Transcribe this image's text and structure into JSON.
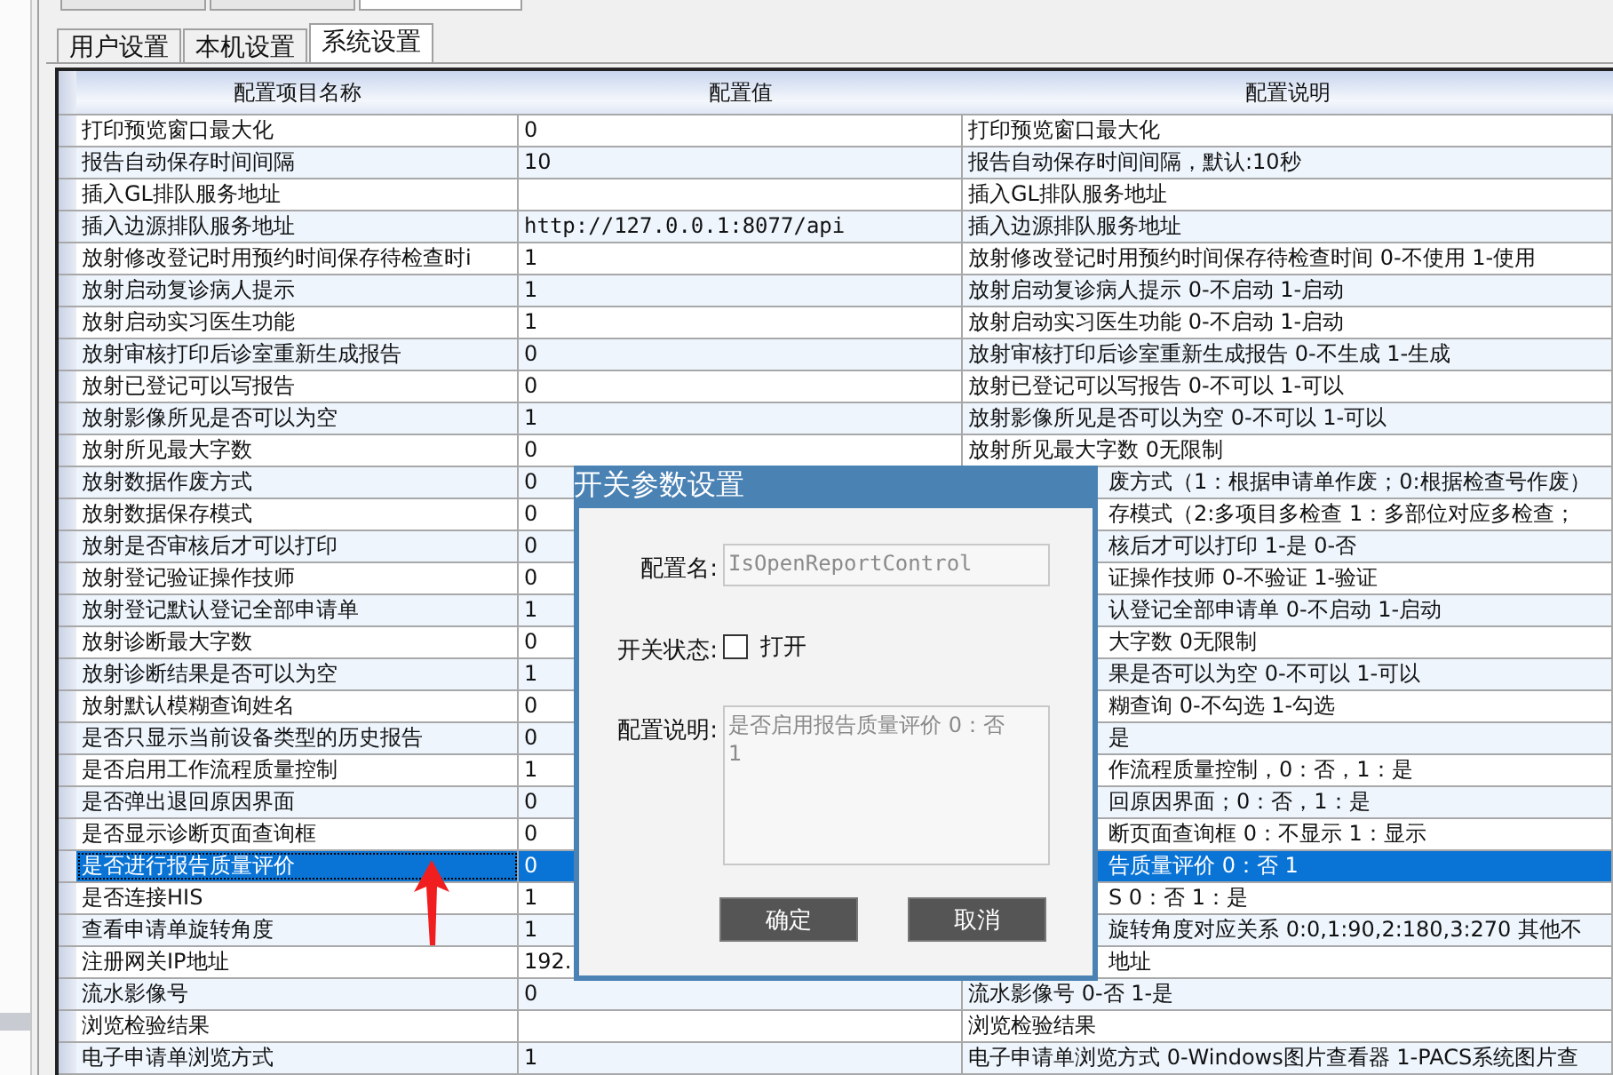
{
  "outer_tabs": [
    {
      "selected": false
    },
    {
      "selected": false
    },
    {
      "selected": true
    }
  ],
  "tabs": [
    {
      "label": "用户设置",
      "selected": false
    },
    {
      "label": "本机设置",
      "selected": false
    },
    {
      "label": "系统设置",
      "selected": true
    }
  ],
  "table": {
    "columns": [
      "配置项目名称",
      "配置值",
      "配置说明"
    ],
    "rows": [
      {
        "name": "打印预览窗口最大化",
        "value": "0",
        "description": "打印预览窗口最大化",
        "covered_by_dialog": false,
        "selected": false
      },
      {
        "name": "报告自动保存时间间隔",
        "value": "10",
        "description": "报告自动保存时间间隔，默认:10秒",
        "covered_by_dialog": false,
        "selected": false
      },
      {
        "name": "插入GL排队服务地址",
        "value": "",
        "description": "插入GL排队服务地址",
        "covered_by_dialog": false,
        "selected": false
      },
      {
        "name": "插入边源排队服务地址",
        "value": "http://127.0.0.1:8077/api",
        "description": "插入边源排队服务地址",
        "covered_by_dialog": false,
        "selected": false
      },
      {
        "name": "放射修改登记时用预约时间保存待检查时i",
        "value": "1",
        "description": "放射修改登记时用预约时间保存待检查时间 0-不使用 1-使用",
        "covered_by_dialog": false,
        "selected": false
      },
      {
        "name": "放射启动复诊病人提示",
        "value": "1",
        "description": "放射启动复诊病人提示 0-不启动 1-启动",
        "covered_by_dialog": false,
        "selected": false
      },
      {
        "name": "放射启动实习医生功能",
        "value": "1",
        "description": "放射启动实习医生功能 0-不启动 1-启动",
        "covered_by_dialog": false,
        "selected": false
      },
      {
        "name": "放射审核打印后诊室重新生成报告",
        "value": "0",
        "description": "放射审核打印后诊室重新生成报告 0-不生成 1-生成",
        "covered_by_dialog": false,
        "selected": false
      },
      {
        "name": "放射已登记可以写报告",
        "value": "0",
        "description": "放射已登记可以写报告 0-不可以 1-可以",
        "covered_by_dialog": false,
        "selected": false
      },
      {
        "name": "放射影像所见是否可以为空",
        "value": "1",
        "description": "放射影像所见是否可以为空 0-不可以 1-可以",
        "covered_by_dialog": false,
        "selected": false
      },
      {
        "name": "放射所见最大字数",
        "value": "0",
        "description": "放射所见最大字数 0无限制",
        "covered_by_dialog": false,
        "selected": false
      },
      {
        "name": "放射数据作废方式",
        "value": "0",
        "description": "废方式（1：根据申请单作废；0:根据检查号作废）",
        "covered_by_dialog": true,
        "selected": false
      },
      {
        "name": "放射数据保存模式",
        "value": "0",
        "description": "存模式（2:多项目多检查 1：多部位对应多检查；",
        "covered_by_dialog": true,
        "selected": false
      },
      {
        "name": "放射是否审核后才可以打印",
        "value": "0",
        "description": "核后才可以打印 1-是 0-否",
        "covered_by_dialog": true,
        "selected": false
      },
      {
        "name": "放射登记验证操作技师",
        "value": "0",
        "description": "证操作技师 0-不验证 1-验证",
        "covered_by_dialog": true,
        "selected": false
      },
      {
        "name": "放射登记默认登记全部申请单",
        "value": "1",
        "description": "认登记全部申请单 0-不启动 1-启动",
        "covered_by_dialog": true,
        "selected": false
      },
      {
        "name": "放射诊断最大字数",
        "value": "0",
        "description": "大字数 0无限制",
        "covered_by_dialog": true,
        "selected": false
      },
      {
        "name": "放射诊断结果是否可以为空",
        "value": "1",
        "description": "果是否可以为空 0-不可以 1-可以",
        "covered_by_dialog": true,
        "selected": false
      },
      {
        "name": "放射默认模糊查询姓名",
        "value": "0",
        "description": "糊查询 0-不勾选 1-勾选",
        "covered_by_dialog": true,
        "selected": false
      },
      {
        "name": "是否只显示当前设备类型的历史报告",
        "value": "0",
        "description": "是",
        "covered_by_dialog": true,
        "selected": false
      },
      {
        "name": "是否启用工作流程质量控制",
        "value": "1",
        "description": "作流程质量控制，0：否，1：是",
        "covered_by_dialog": true,
        "selected": false
      },
      {
        "name": "是否弹出退回原因界面",
        "value": "0",
        "description": "回原因界面；0：否，1：是",
        "covered_by_dialog": true,
        "selected": false
      },
      {
        "name": "是否显示诊断页面查询框",
        "value": "0",
        "description": "断页面查询框 0：不显示 1：显示",
        "covered_by_dialog": true,
        "selected": false
      },
      {
        "name": "是否进行报告质量评价",
        "value": "0",
        "description": "告质量评价 0：否 1",
        "covered_by_dialog": true,
        "selected": true
      },
      {
        "name": "是否连接HIS",
        "value": "1",
        "description": "S 0：否 1：是",
        "covered_by_dialog": true,
        "selected": false
      },
      {
        "name": "查看申请单旋转角度",
        "value": "1",
        "description": "旋转角度对应关系 0:0,1:90,2:180,3:270 其他不",
        "covered_by_dialog": true,
        "selected": false
      },
      {
        "name": "注册网关IP地址",
        "value": "192.",
        "description": "地址",
        "covered_by_dialog": true,
        "selected": false
      },
      {
        "name": "流水影像号",
        "value": "0",
        "description": "流水影像号 0-否 1-是",
        "covered_by_dialog": false,
        "selected": false
      },
      {
        "name": "浏览检验结果",
        "value": "",
        "description": "浏览检验结果",
        "covered_by_dialog": false,
        "selected": false
      },
      {
        "name": "电子申请单浏览方式",
        "value": "1",
        "description": "电子申请单浏览方式 0-Windows图片查看器 1-PACS系统图片查",
        "covered_by_dialog": false,
        "selected": false
      }
    ]
  },
  "dialog": {
    "title": "开关参数设置",
    "name_label": "配置名:",
    "name_value": "IsOpenReportControl",
    "switch_label": "开关状态:",
    "switch_option": "打开",
    "checked": false,
    "description_label": "配置说明:",
    "description_value": "是否启用报告质量评价 0：否\n1",
    "buttons": [
      "确定",
      "取消"
    ]
  }
}
